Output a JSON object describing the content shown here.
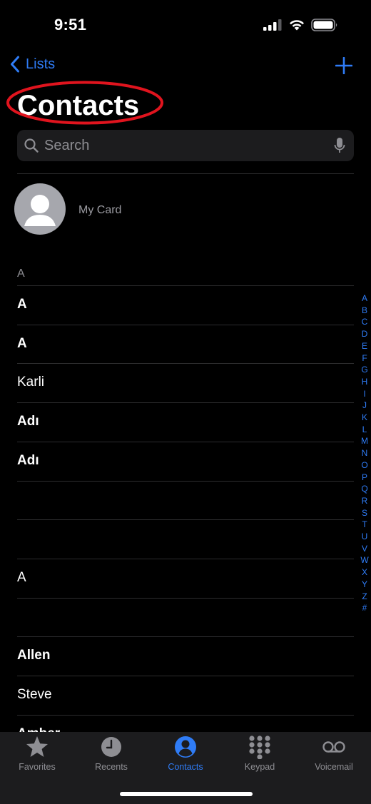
{
  "status": {
    "time": "9:51"
  },
  "nav": {
    "back_label": "Lists"
  },
  "title": "Contacts",
  "search": {
    "placeholder": "Search"
  },
  "my_card_label": "My Card",
  "section_letter": "A",
  "contacts": [
    {
      "name": "A",
      "bold": true
    },
    {
      "name": "A",
      "bold": true
    },
    {
      "name": "Karli",
      "bold": false
    },
    {
      "name": "Adı",
      "bold": true
    },
    {
      "name": "Adı",
      "bold": true
    },
    {
      "name": "",
      "bold": false
    },
    {
      "name": "",
      "bold": false
    },
    {
      "name": "A",
      "bold": false
    },
    {
      "name": "",
      "bold": false
    },
    {
      "name": "Allen",
      "bold": true
    },
    {
      "name": "Steve",
      "bold": false
    },
    {
      "name": "Amber",
      "bold": true
    }
  ],
  "index_letters": [
    "A",
    "B",
    "C",
    "D",
    "E",
    "F",
    "G",
    "H",
    "I",
    "J",
    "K",
    "L",
    "M",
    "N",
    "O",
    "P",
    "Q",
    "R",
    "S",
    "T",
    "U",
    "V",
    "W",
    "X",
    "Y",
    "Z",
    "#"
  ],
  "tabs": [
    {
      "label": "Favorites",
      "icon": "star-icon",
      "active": false
    },
    {
      "label": "Recents",
      "icon": "clock-icon",
      "active": false
    },
    {
      "label": "Contacts",
      "icon": "person-circle-icon",
      "active": true
    },
    {
      "label": "Keypad",
      "icon": "keypad-icon",
      "active": false
    },
    {
      "label": "Voicemail",
      "icon": "voicemail-icon",
      "active": false
    }
  ],
  "colors": {
    "accent": "#2f7cf6",
    "annotation": "#e0141e",
    "background": "#000000",
    "tabbar": "#1c1c1e"
  }
}
